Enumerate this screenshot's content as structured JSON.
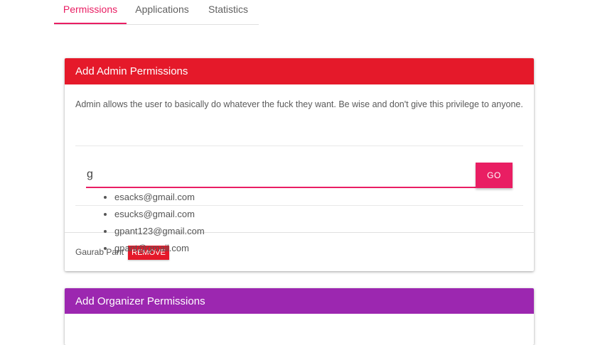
{
  "tabs": [
    {
      "label": "Permissions",
      "active": true
    },
    {
      "label": "Applications",
      "active": false
    },
    {
      "label": "Statistics",
      "active": false
    }
  ],
  "admin_card": {
    "title": "Add Admin Permissions",
    "description": "Admin allows the user to basically do whatever the fuck they want. Be wise and don't give this privilege to anyone.",
    "search_value": "g",
    "go_label": "GO",
    "suggestions": [
      "esacks@gmail.com",
      "esucks@gmail.com",
      "gpant123@gmail.com",
      "gpant@gmail.com"
    ],
    "current_user": "Gaurab Pant",
    "remove_label": "REMOVE"
  },
  "organizer_card": {
    "title": "Add Organizer Permissions"
  },
  "colors": {
    "accent": "#e91e63",
    "admin_header": "#e5192a",
    "organizer_header": "#9c27b0"
  }
}
